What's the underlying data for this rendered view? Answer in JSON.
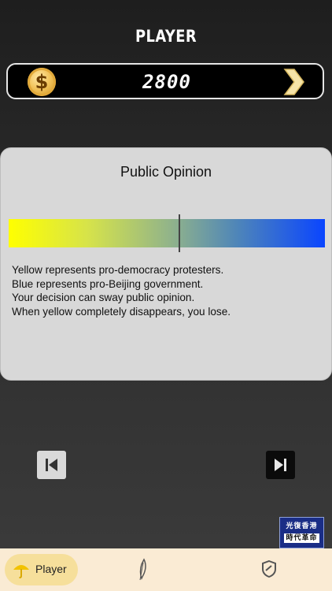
{
  "header": {
    "title": "PLAYER"
  },
  "coins": {
    "value": "2800",
    "currency_symbol": "$",
    "icon": "coin-icon",
    "next_icon": "chevron-right-icon"
  },
  "opinion_panel": {
    "title": "Public Opinion",
    "yellow_share": 0.54,
    "colors": {
      "yellow": "#ffff00",
      "blue": "#0a45ff"
    },
    "description": [
      "Yellow represents pro-democracy protesters.",
      "Blue represents pro-Beijing government.",
      "Your decision can sway public opinion.",
      "When yellow completely disappears, you lose."
    ]
  },
  "navigation": {
    "prev_icon": "skip-previous-icon",
    "next_icon": "skip-next-icon"
  },
  "badge": {
    "line1": "光復香港",
    "line2": "時代革命"
  },
  "bottom_nav": {
    "items": [
      {
        "label": "Player",
        "icon": "umbrella-icon",
        "active": true
      },
      {
        "label": "",
        "icon": "feather-icon",
        "active": false
      },
      {
        "label": "",
        "icon": "shield-icon",
        "active": false
      }
    ]
  },
  "accent_colors": {
    "bottom_nav_bg": "#faebd4",
    "active_tab_bg": "#f6df9b"
  }
}
